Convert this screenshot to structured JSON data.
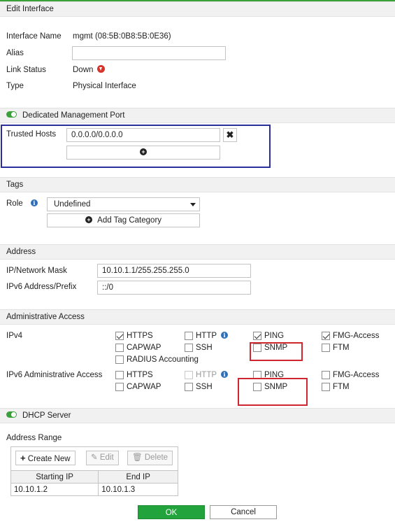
{
  "dialog": {
    "title": "Edit Interface"
  },
  "interface": {
    "name_label": "Interface Name",
    "name_value": "mgmt (08:5B:0B8:5B:0E36)",
    "alias_label": "Alias",
    "alias_value": "",
    "link_status_label": "Link Status",
    "link_status_value": "Down",
    "type_label": "Type",
    "type_value": "Physical Interface"
  },
  "dedicated_mgmt": {
    "label": "Dedicated Management Port",
    "enabled": true,
    "trusted_hosts_label": "Trusted Hosts",
    "trusted_hosts_value": "0.0.0.0/0.0.0.0",
    "remove_icon": "close-icon",
    "add_icon": "plus-circle-icon"
  },
  "tags": {
    "header": "Tags",
    "role_label": "Role",
    "role_value": "Undefined",
    "add_tag_category": "Add Tag Category"
  },
  "address": {
    "header": "Address",
    "ip_label": "IP/Network Mask",
    "ip_value": "10.10.1.1/255.255.255.0",
    "ipv6_label": "IPv6 Address/Prefix",
    "ipv6_value": "::/0"
  },
  "admin_access": {
    "header": "Administrative Access",
    "ipv4_label": "IPv4",
    "ipv6_label": "IPv6 Administrative Access",
    "ipv4": {
      "https": {
        "label": "HTTPS",
        "checked": true
      },
      "http": {
        "label": "HTTP",
        "checked": false
      },
      "ping": {
        "label": "PING",
        "checked": true
      },
      "fmg": {
        "label": "FMG-Access",
        "checked": true
      },
      "capwap": {
        "label": "CAPWAP",
        "checked": false
      },
      "ssh": {
        "label": "SSH",
        "checked": false
      },
      "snmp": {
        "label": "SNMP",
        "checked": false
      },
      "ftm": {
        "label": "FTM",
        "checked": false
      },
      "radius": {
        "label": "RADIUS Accounting",
        "checked": false
      }
    },
    "ipv6": {
      "https": {
        "label": "HTTPS",
        "checked": false
      },
      "http": {
        "label": "HTTP",
        "checked": false
      },
      "ping": {
        "label": "PING",
        "checked": false
      },
      "fmg": {
        "label": "FMG-Access",
        "checked": false
      },
      "capwap": {
        "label": "CAPWAP",
        "checked": false
      },
      "ssh": {
        "label": "SSH",
        "checked": false
      },
      "snmp": {
        "label": "SNMP",
        "checked": false
      },
      "ftm": {
        "label": "FTM",
        "checked": false
      }
    }
  },
  "dhcp": {
    "header": "DHCP Server",
    "enabled": true,
    "address_range_label": "Address Range",
    "create_new": "Create New",
    "edit": "Edit",
    "delete": "Delete",
    "columns": [
      "Starting IP",
      "End IP"
    ],
    "rows": [
      [
        "10.10.1.2",
        "10.10.1.3"
      ]
    ]
  },
  "footer": {
    "ok": "OK",
    "cancel": "Cancel"
  },
  "colors": {
    "accent": "#22a33b",
    "highlight_blue": "#2b2f9c",
    "highlight_red": "#d0262f"
  }
}
